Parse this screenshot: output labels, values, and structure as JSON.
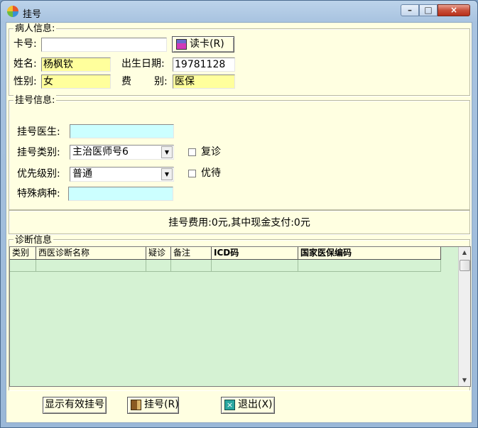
{
  "window": {
    "title": "挂号",
    "close_glyph": "×",
    "min_glyph": "–",
    "max_glyph": "□"
  },
  "patient": {
    "legend": "病人信息:",
    "card_label": "卡号:",
    "card_value": "",
    "read_card_button": "读卡(R)",
    "name_label": "姓名:",
    "name_value": "杨枫钦",
    "birth_label": "出生日期:",
    "birth_value": "19781128",
    "gender_label": "性别:",
    "gender_value": "女",
    "fee_label_1": "费",
    "fee_label_2": "别:",
    "fee_value": "医保"
  },
  "registration": {
    "legend": "挂号信息:",
    "doctor_label": "挂号医生:",
    "doctor_value": "",
    "type_label": "挂号类别:",
    "type_value": "主治医师号6",
    "revisit_label": "复诊",
    "priority_label": "优先级别:",
    "priority_value": "普通",
    "preferential_label": "优待",
    "disease_label": "特殊病种:",
    "disease_value": ""
  },
  "fee_summary": "挂号费用:0元,其中现金支付:0元",
  "diagnosis": {
    "legend": "诊断信息",
    "columns": [
      "类别",
      "西医诊断名称",
      "疑诊",
      "备注",
      "ICD码",
      "国家医保编码"
    ]
  },
  "footer": {
    "show_valid_button": "显示有效挂号",
    "register_button": "挂号(R)",
    "exit_button": "退出(X)"
  },
  "colors": {
    "client_bg": "#ffffe1",
    "highlight_field": "#ffff9c",
    "input_cyan": "#ccffff",
    "grid_bg": "#d5f2d3"
  }
}
